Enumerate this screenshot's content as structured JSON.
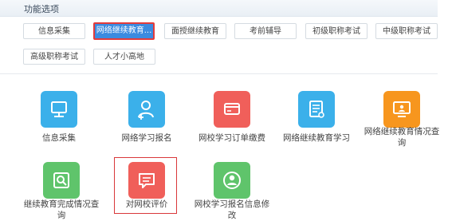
{
  "panel": {
    "title": "功能选项"
  },
  "options": [
    {
      "label": "信息采集"
    },
    {
      "label": "网络继续教育..."
    },
    {
      "label": "面授继续教育"
    },
    {
      "label": "考前辅导"
    },
    {
      "label": "初级职称考试"
    },
    {
      "label": "中级职称考试"
    },
    {
      "label": "高级职称考试"
    },
    {
      "label": "人才小高地"
    }
  ],
  "active_option": "网络继续教育...",
  "modules": [
    {
      "label": "信息采集",
      "icon": "monitor-icon",
      "color": "#3bb0ea"
    },
    {
      "label": "网络学习报名",
      "icon": "user-add-icon",
      "color": "#3bb0ea"
    },
    {
      "label": "网校学习订单缴费",
      "icon": "card-icon",
      "color": "#f05f5a"
    },
    {
      "label": "网络继续教育学习",
      "icon": "document-icon",
      "color": "#3bb0ea"
    },
    {
      "label": "网络继续教育情况查询",
      "icon": "screen-user-icon",
      "color": "#f7961e"
    },
    {
      "label": "继续教育完成情况查询",
      "icon": "search-icon",
      "color": "#5fc46b"
    },
    {
      "label": "对网校评价",
      "icon": "chat-icon",
      "color": "#f05f5a"
    },
    {
      "label": "网校学习报名信息修改",
      "icon": "user-circle-icon",
      "color": "#5fc46b"
    }
  ],
  "selected_module": "对网校评价"
}
